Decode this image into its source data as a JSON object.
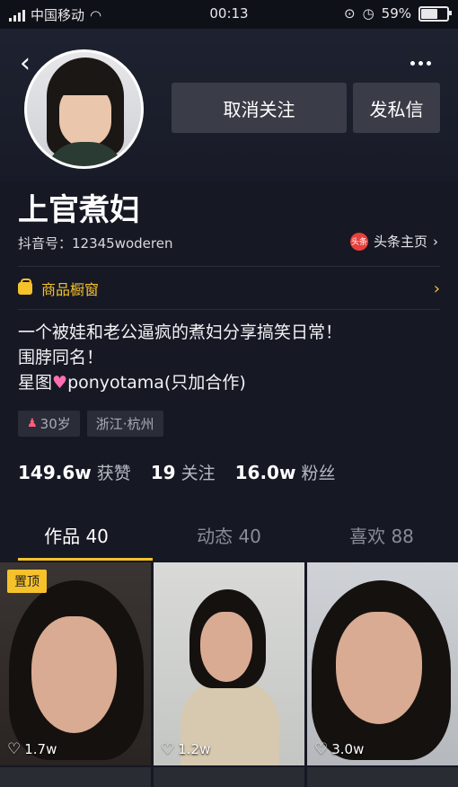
{
  "status_bar": {
    "carrier": "中国移动",
    "time": "00:13",
    "battery": "59%",
    "battery_level": 0.59
  },
  "profile": {
    "nickname": "上官煮妇",
    "douyin_id": "抖音号：12345woderen",
    "toutiao_label": "头条主页",
    "toutiao_logo": "头条",
    "unfollow_label": "取消关注",
    "message_label": "发私信"
  },
  "shop": {
    "label": "商品橱窗"
  },
  "bio": {
    "line1": "一个被娃和老公逼疯的煮妇分享搞笑日常！",
    "line2": "围脖同名！",
    "line3_prefix": "星图",
    "line3_suffix": "ponyotama(只加合作)"
  },
  "tags": {
    "age": "30岁",
    "location": "浙江·杭州"
  },
  "stats": [
    {
      "value": "149.6w",
      "label": "获赞"
    },
    {
      "value": "19",
      "label": "关注"
    },
    {
      "value": "16.0w",
      "label": "粉丝"
    }
  ],
  "tabs": [
    {
      "label": "作品 40",
      "active": true
    },
    {
      "label": "动态 40",
      "active": false
    },
    {
      "label": "喜欢 88",
      "active": false
    }
  ],
  "videos": [
    {
      "pinned_label": "置顶",
      "likes": "1.7w"
    },
    {
      "likes": "1.2w"
    },
    {
      "likes": "3.0w"
    }
  ],
  "colors": {
    "accent": "#f6c22b",
    "background": "#161824"
  },
  "icons": [
    "back-arrow-icon",
    "more-icon",
    "heart-icon",
    "shop-icon",
    "chevron-right-icon"
  ]
}
